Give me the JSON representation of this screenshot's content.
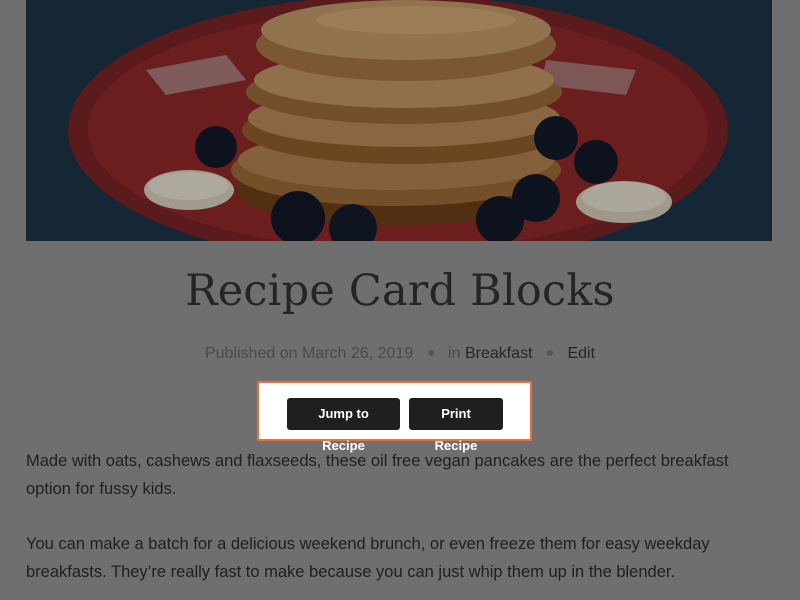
{
  "post": {
    "title": "Recipe Card Blocks",
    "published_prefix": "Published on",
    "published_date": "March 26, 2019",
    "category_prefix": "in",
    "category": "Breakfast",
    "edit_label": "Edit"
  },
  "recipe_buttons": {
    "jump_label": "Jump to Recipe",
    "print_label": "Print Recipe",
    "highlight_color": "#e8723a"
  },
  "content": {
    "paragraphs": [
      "Made with oats, cashews and flaxseeds, these oil free vegan pancakes are the perfect breakfast option for fussy kids.",
      "You can make a batch for a delicious weekend brunch, or even freeze them for easy weekday breakfasts. They’re really fast to make because you can just whip them up in the blender."
    ]
  },
  "hero_image": {
    "subject": "stack of pancakes with blueberries and banana on red plate"
  }
}
